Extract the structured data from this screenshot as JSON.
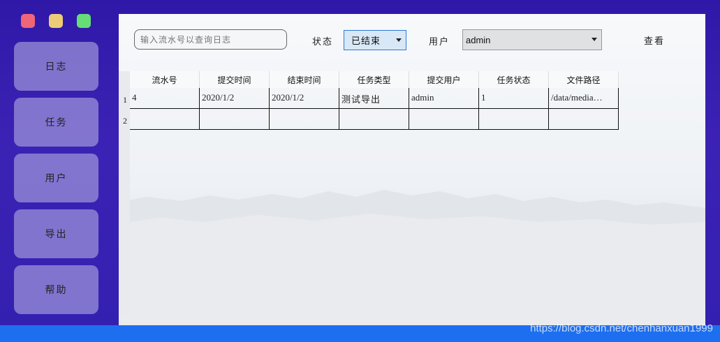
{
  "sidebar": {
    "items": [
      {
        "label": "日志"
      },
      {
        "label": "任务"
      },
      {
        "label": "用户"
      },
      {
        "label": "导出"
      },
      {
        "label": "帮助"
      }
    ]
  },
  "toolbar": {
    "search_placeholder": "输入流水号以查询日志",
    "status_label": "状态",
    "status_value": "已结束",
    "user_label": "用户",
    "user_value": "admin",
    "view_label": "查看"
  },
  "table": {
    "columns": [
      "流水号",
      "提交时间",
      "结束时间",
      "任务类型",
      "提交用户",
      "任务状态",
      "文件路径"
    ],
    "row_numbers": [
      "1",
      "2"
    ],
    "rows": [
      [
        "4",
        "2020/1/2",
        "2020/1/2",
        "测试导出",
        "admin",
        "1",
        "/data/media…"
      ],
      [
        "",
        "",
        "",
        "",
        "",
        "",
        ""
      ]
    ]
  },
  "watermark": "https://blog.csdn.net/chenhanxuan1999",
  "colors": {
    "window_bg": "#3a1fb0",
    "bottom_bar": "#1e6ff0",
    "traffic_red": "#ee6677",
    "traffic_yellow": "#eecc77",
    "traffic_green": "#66dd77",
    "status_select_border": "#2a7ad8"
  }
}
